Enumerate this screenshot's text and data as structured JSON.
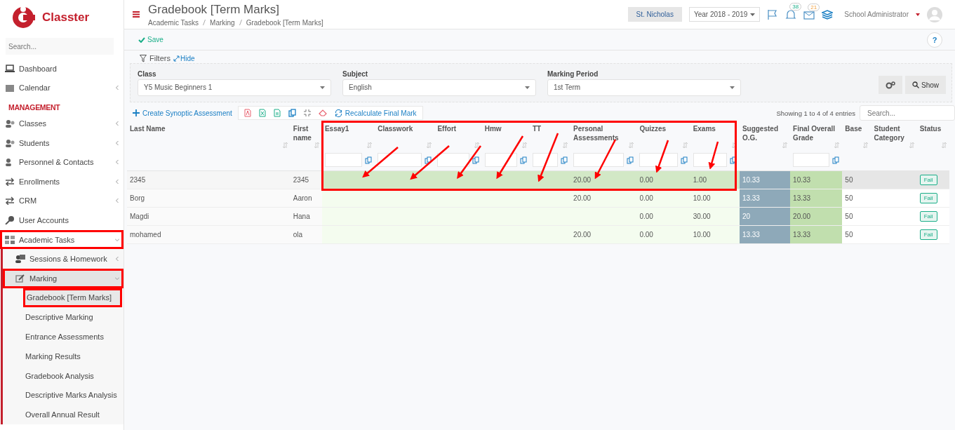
{
  "brand": {
    "name": "Classter"
  },
  "sidebar": {
    "search_placeholder": "Search...",
    "items": [
      {
        "label": "Dashboard",
        "kind": "item",
        "selected": false,
        "highlighted": false
      },
      {
        "label": "Calendar",
        "kind": "item",
        "expanded": false,
        "selected": false,
        "highlighted": false
      },
      {
        "label": "MANAGEMENT",
        "kind": "section"
      },
      {
        "label": "Classes",
        "kind": "item",
        "expanded": false,
        "selected": false,
        "highlighted": false
      },
      {
        "label": "Students",
        "kind": "item",
        "expanded": false,
        "selected": false,
        "highlighted": false
      },
      {
        "label": "Personnel & Contacts",
        "kind": "item",
        "expanded": false,
        "selected": false,
        "highlighted": false
      },
      {
        "label": "Enrollments",
        "kind": "item",
        "expanded": false,
        "selected": false,
        "highlighted": false
      },
      {
        "label": "CRM",
        "kind": "item",
        "expanded": false,
        "selected": false,
        "highlighted": false
      },
      {
        "label": "User Accounts",
        "kind": "item",
        "selected": false,
        "highlighted": false
      },
      {
        "label": "Academic Tasks",
        "kind": "item",
        "expanded": true,
        "selected": false,
        "highlighted": true,
        "children": [
          {
            "label": "Sessions & Homework",
            "expanded": false,
            "selected": false,
            "highlighted": false
          },
          {
            "label": "Marking",
            "expanded": true,
            "selected": true,
            "highlighted": true,
            "children": [
              {
                "label": "Gradebook [Term Marks]",
                "selected": true,
                "highlighted": true
              },
              {
                "label": "Descriptive Marking",
                "selected": false,
                "highlighted": false
              },
              {
                "label": "Entrance Assessments",
                "selected": false,
                "highlighted": false
              },
              {
                "label": "Marking Results",
                "selected": false,
                "highlighted": false
              },
              {
                "label": "Gradebook Analysis",
                "selected": false,
                "highlighted": false
              },
              {
                "label": "Descriptive Marks Analysis",
                "selected": false,
                "highlighted": false
              },
              {
                "label": "Overall Annual Result",
                "selected": false,
                "highlighted": false
              }
            ]
          }
        ]
      }
    ]
  },
  "header": {
    "title": "Gradebook [Term Marks]",
    "breadcrumb": [
      "Academic Tasks",
      "Marking",
      "Gradebook [Term Marks]"
    ],
    "school": "St. Nicholas",
    "year": "Year 2018 - 2019",
    "notifications": "38",
    "messages": "21",
    "user": "School Administrator"
  },
  "toolbar": {
    "save": "Save",
    "help": "?"
  },
  "filters": {
    "title": "Filters",
    "hide": "Hide",
    "fields": [
      {
        "label": "Class",
        "value": "Y5 Music Beginners 1"
      },
      {
        "label": "Subject",
        "value": "English"
      },
      {
        "label": "Marking Period",
        "value": "1st Term"
      }
    ],
    "show": "Show"
  },
  "actions": {
    "create": "Create Synoptic Assessment",
    "recalculate": "Recalculate Final Mark",
    "info": "Showing 1 to 4 of 4 entries",
    "search_placeholder": "Search..."
  },
  "table": {
    "columns": [
      {
        "label": "Last Name",
        "kind": "name",
        "filter": false
      },
      {
        "label": "First name",
        "kind": "name",
        "filter": false
      },
      {
        "label": "Essay1",
        "kind": "mark",
        "filter": true
      },
      {
        "label": "Classwork",
        "kind": "mark",
        "filter": true
      },
      {
        "label": "Effort",
        "kind": "mark",
        "filter": true
      },
      {
        "label": "Hmw",
        "kind": "mark",
        "filter": true
      },
      {
        "label": "TT",
        "kind": "mark",
        "filter": true
      },
      {
        "label": "Personal Assessments",
        "kind": "mark",
        "filter": true
      },
      {
        "label": "Quizzes",
        "kind": "mark",
        "filter": true
      },
      {
        "label": "Exams",
        "kind": "mark",
        "filter": true
      },
      {
        "label": "Suggested O.G.",
        "kind": "suggested",
        "filter": false
      },
      {
        "label": "Final Overall Grade",
        "kind": "final",
        "filter": true
      },
      {
        "label": "Base",
        "kind": "plain",
        "filter": false
      },
      {
        "label": "Student Category",
        "kind": "plain",
        "filter": false
      },
      {
        "label": "Status",
        "kind": "status",
        "filter": false
      }
    ],
    "rows": [
      {
        "highlighted": true,
        "last_name": "2345",
        "first_name": "2345",
        "personal_assessments": "20.00",
        "quizzes": "0.00",
        "exams": "1.00",
        "suggested_og": "10.33",
        "final_overall_grade": "10.33",
        "base": "50",
        "status": "Fail"
      },
      {
        "highlighted": false,
        "last_name": "Borg",
        "first_name": "Aaron",
        "personal_assessments": "20.00",
        "quizzes": "0.00",
        "exams": "10.00",
        "suggested_og": "13.33",
        "final_overall_grade": "13.33",
        "base": "50",
        "status": "Fail"
      },
      {
        "highlighted": false,
        "last_name": "Magdi",
        "first_name": "Hana",
        "quizzes": "0.00",
        "exams": "30.00",
        "suggested_og": "20",
        "final_overall_grade": "20.00",
        "base": "50",
        "status": "Fail"
      },
      {
        "highlighted": false,
        "last_name": "mohamed",
        "first_name": "ola",
        "personal_assessments": "20.00",
        "quizzes": "0.00",
        "exams": "10.00",
        "suggested_og": "13.33",
        "final_overall_grade": "13.33",
        "base": "50",
        "status": "Fail"
      }
    ]
  }
}
